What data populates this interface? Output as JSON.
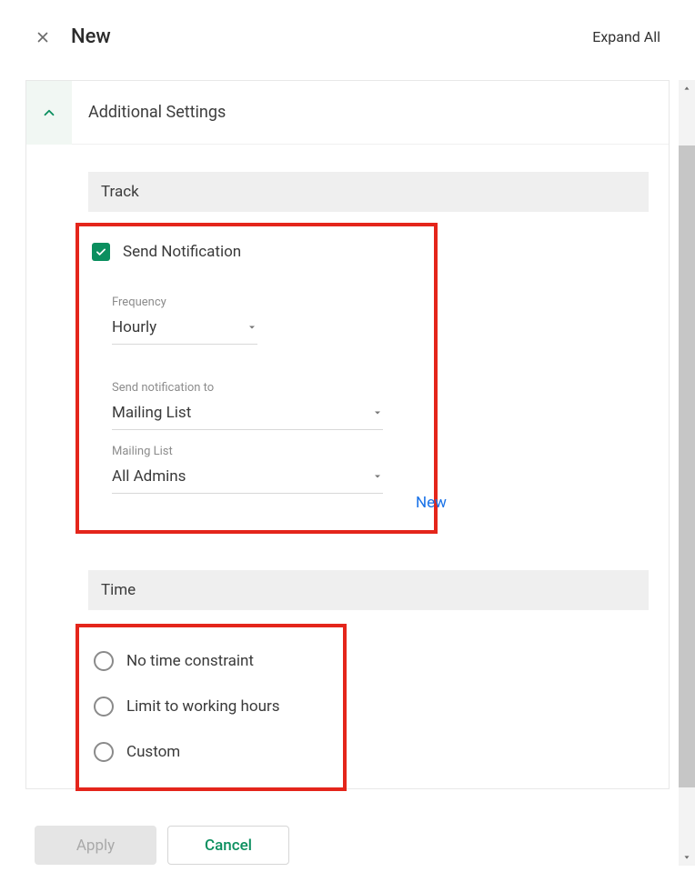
{
  "header": {
    "title": "New",
    "expand_all": "Expand All"
  },
  "accordion": {
    "title": "Additional Settings"
  },
  "sections": {
    "track": {
      "title": "Track",
      "send_notification_label": "Send Notification",
      "frequency_label": "Frequency",
      "frequency_value": "Hourly",
      "send_to_label": "Send notification to",
      "send_to_value": "Mailing List",
      "mailing_list_label": "Mailing List",
      "mailing_list_value": "All Admins",
      "new_link": "New"
    },
    "time": {
      "title": "Time",
      "options": {
        "no_constraint": "No time constraint",
        "limit_working": "Limit to working hours",
        "custom": "Custom"
      }
    }
  },
  "footer": {
    "apply": "Apply",
    "cancel": "Cancel"
  }
}
